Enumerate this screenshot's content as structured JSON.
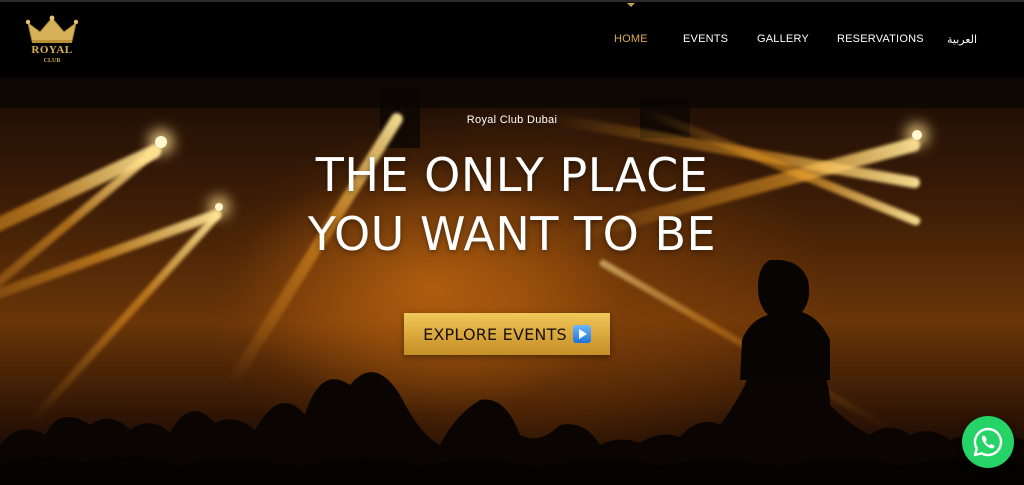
{
  "logo": {
    "title": "ROYAL",
    "subtitle": "CLUB"
  },
  "nav": {
    "items": [
      {
        "label": "HOME",
        "active": true
      },
      {
        "label": "EVENTS",
        "active": false
      },
      {
        "label": "GALLERY",
        "active": false
      },
      {
        "label": "RESERVATIONS",
        "active": false
      },
      {
        "label": "العربية",
        "active": false
      }
    ]
  },
  "hero": {
    "eyebrow": "Royal Club Dubai",
    "headline_line1": "THE ONLY PLACE",
    "headline_line2": "YOU WANT TO BE",
    "cta_label": "EXPLORE EVENTS",
    "cta_icon": "play-icon"
  },
  "whatsapp": {
    "icon": "whatsapp-icon"
  },
  "colors": {
    "accent": "#d9ac4f",
    "nav_bg": "#000000",
    "cta_gold": "#e3b44a",
    "whatsapp_green": "#25d366"
  }
}
